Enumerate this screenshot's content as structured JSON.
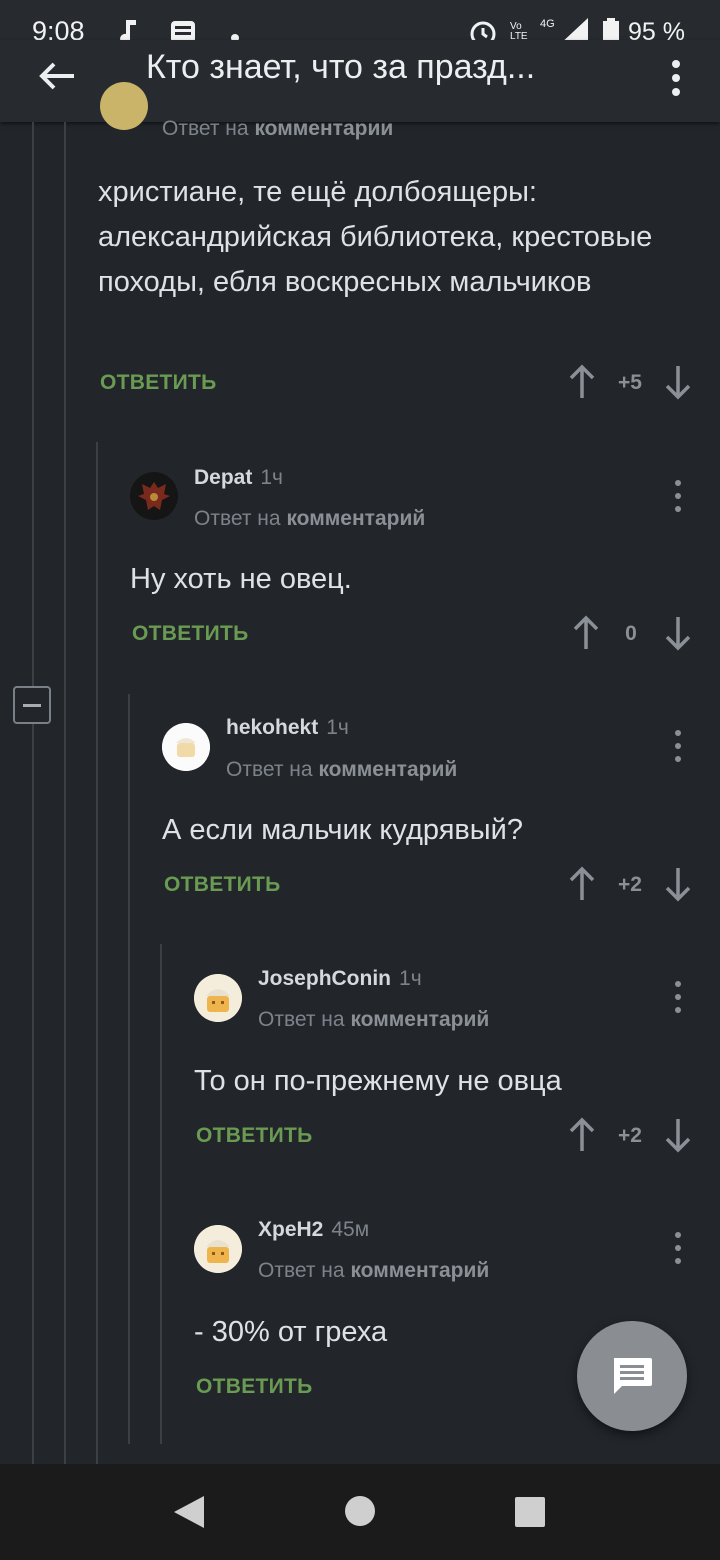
{
  "status_bar": {
    "time": "9:08",
    "volte": "Vo LTE",
    "network": "4G",
    "battery": "95 %"
  },
  "app_bar": {
    "title": "Кто знает, что за празд..."
  },
  "comments": [
    {
      "reply_prefix": "Ответ на",
      "reply_target": "комментарии",
      "text": "христиане, те ещё долбоящеры: александрийская библиотека, крестовые походы, ебля воскресных мальчиков",
      "reply_label": "ОТВЕТИТЬ",
      "score": "+5"
    },
    {
      "author": "Depat",
      "time": "1ч",
      "reply_prefix": "Ответ на",
      "reply_target": "комментарий",
      "text": "Ну хоть не овец.",
      "reply_label": "ОТВЕТИТЬ",
      "score": "0"
    },
    {
      "author": "hekohekt",
      "time": "1ч",
      "reply_prefix": "Ответ на",
      "reply_target": "комментарий",
      "text": "А если мальчик кудрявый?",
      "reply_label": "ОТВЕТИТЬ",
      "score": "+2"
    },
    {
      "author": "JosephConin",
      "time": "1ч",
      "reply_prefix": "Ответ на",
      "reply_target": "комментарий",
      "text": "То он по-прежнему не овца",
      "reply_label": "ОТВЕТИТЬ",
      "score": "+2"
    },
    {
      "author": "ХреН2",
      "time": "45м",
      "reply_prefix": "Ответ на",
      "reply_target": "комментарий",
      "text": "- 30% от греха",
      "reply_label": "ОТВЕТИТЬ"
    }
  ],
  "icons": {
    "back": "arrow-left-icon",
    "menu": "more-vert-icon",
    "vote_up": "arrow-up-icon",
    "vote_down": "arrow-down-icon",
    "fab": "comment-icon",
    "nav_back": "triangle-back-icon",
    "nav_home": "circle-home-icon",
    "nav_recents": "square-recents-icon"
  },
  "colors": {
    "background": "#22262b",
    "accent_reply": "#6a9b52",
    "text": "#dfe2e5",
    "muted": "#7d838a"
  }
}
